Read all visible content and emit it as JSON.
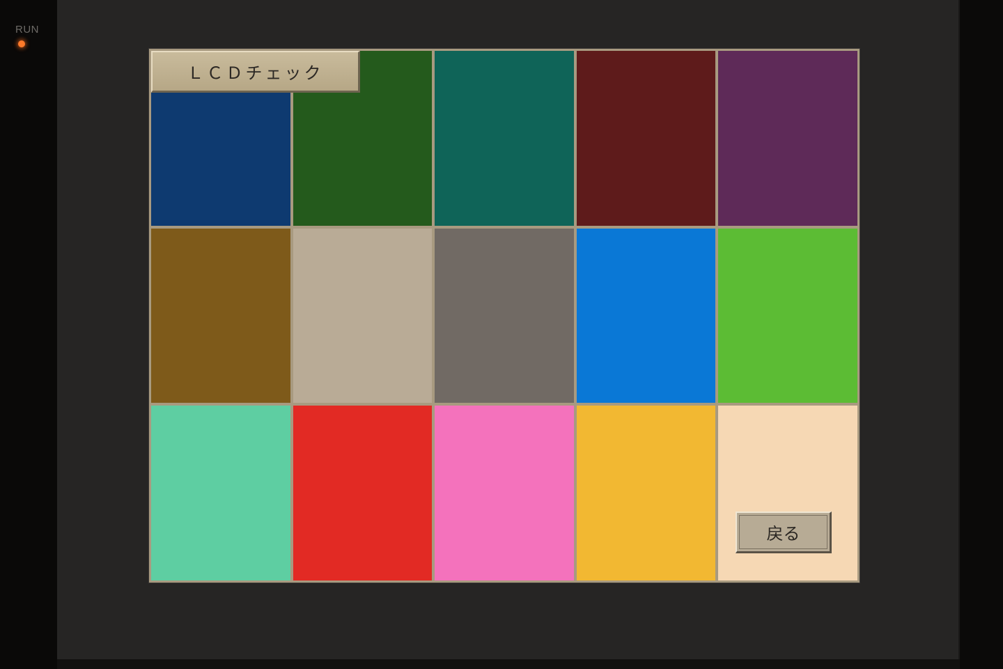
{
  "panel": {
    "status_label": "RUN",
    "led_color": "#ff7a2a"
  },
  "screen": {
    "title": "ＬＣＤチェック",
    "back_label": "戻る",
    "swatches": [
      "#0e3a70",
      "#245a1c",
      "#0f6458",
      "#5e1b1b",
      "#5e2a58",
      "#7e5a1a",
      "#b9ab96",
      "#716a64",
      "#0a78d6",
      "#5cbc34",
      "#5ecea2",
      "#e22a24",
      "#f472bc",
      "#f2b832",
      "#f6d8b4"
    ]
  }
}
